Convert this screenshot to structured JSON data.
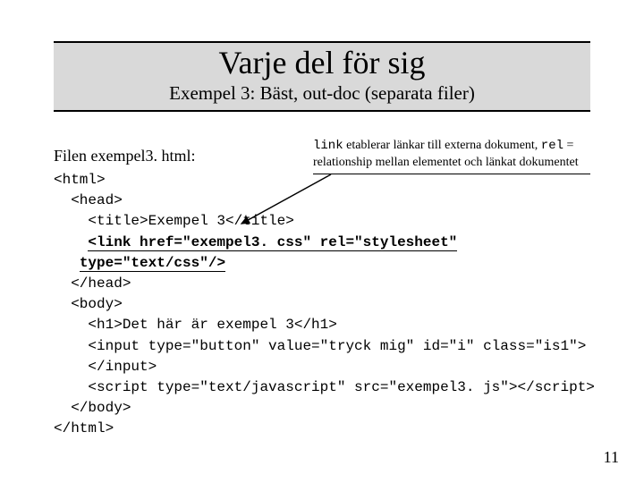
{
  "title": {
    "main": "Varje del för sig",
    "sub": "Exempel 3: Bäst, out-doc (separata filer)"
  },
  "filelabel": "Filen exempel3. html:",
  "annotation": {
    "pre": "",
    "code1": "link",
    "mid1": " etablerar länkar till externa dokument, ",
    "code2": "rel",
    "mid2": " = relationship mellan elementet och länkat dokumentet"
  },
  "code": {
    "l1": "<html>",
    "l2": "  <head>",
    "l3": "    <title>Exempel 3</title>",
    "l4a": "    ",
    "l4hl": "<link href=\"exempel3. css\" rel=\"stylesheet\"",
    "l5a": "   ",
    "l5hl": "type=\"text/css\"/>",
    "l6": "  </head>",
    "l7": "  <body>",
    "l8": "    <h1>Det här är exempel 3</h1>",
    "l9": "    <input type=\"button\" value=\"tryck mig\" id=\"i\" class=\"is1\">",
    "l10": "    </input>",
    "l11": "    <script type=\"text/javascript\" src=\"exempel3. js\"></script>",
    "l12": "  </body>",
    "l13": "</html>"
  },
  "pagenum": "11"
}
